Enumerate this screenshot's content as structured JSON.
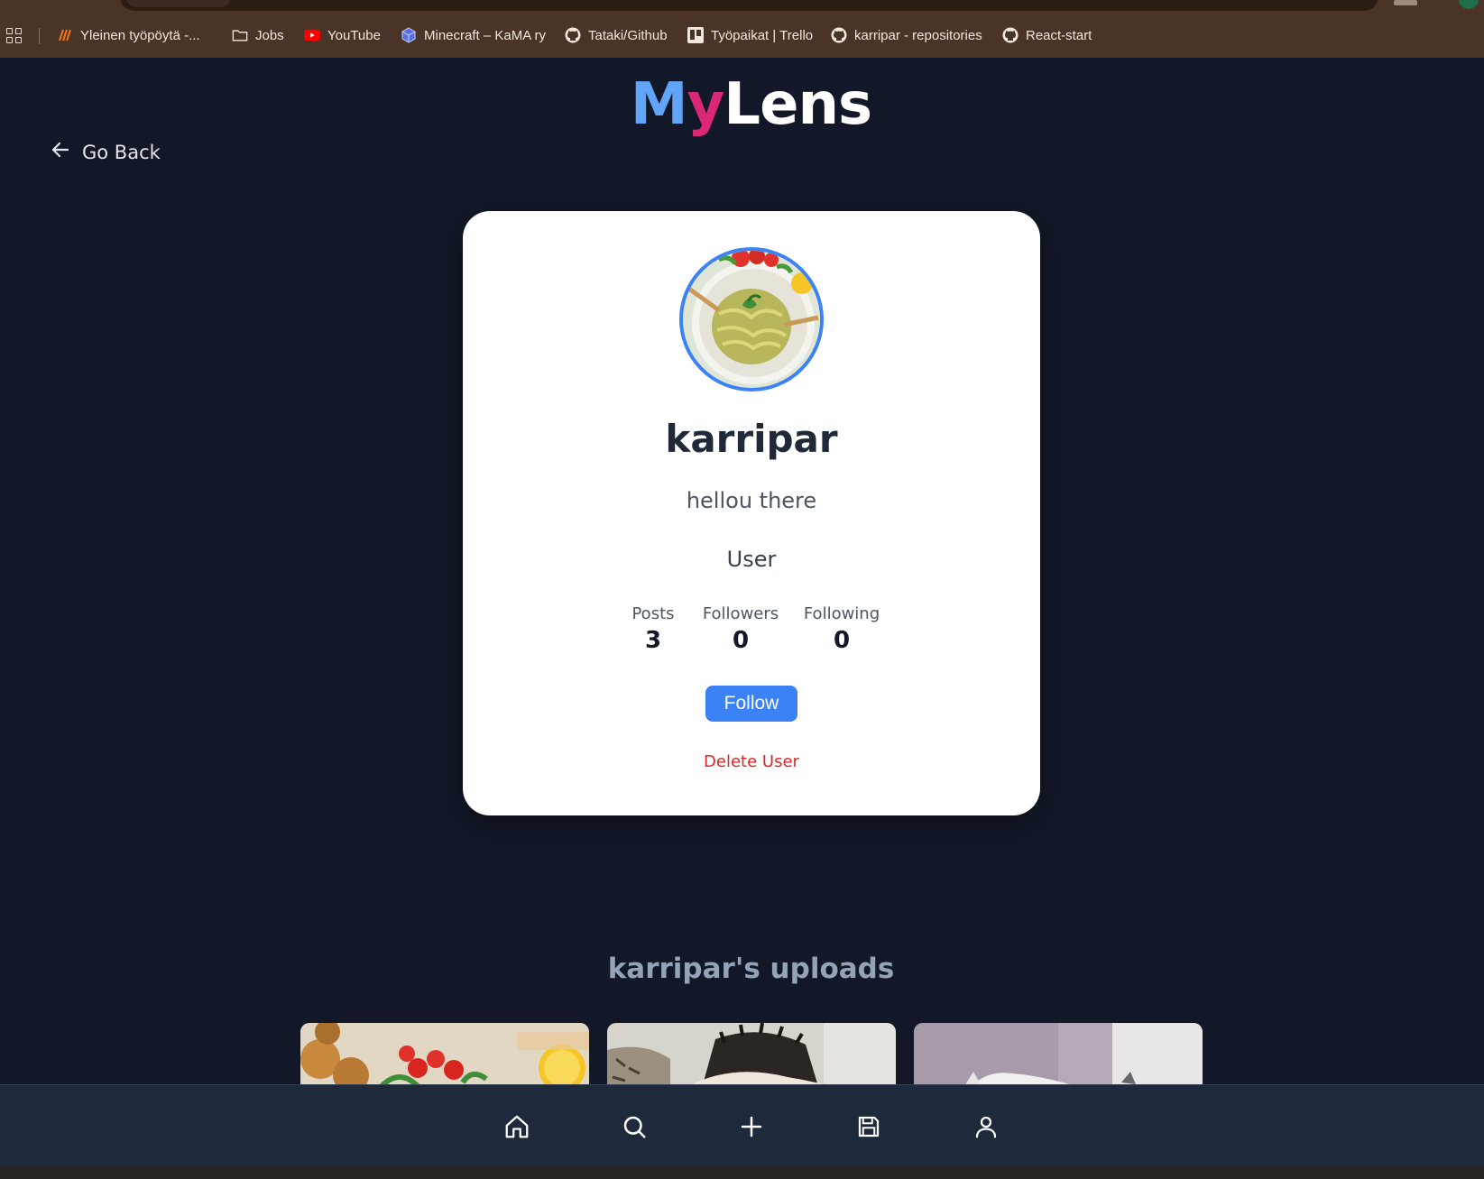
{
  "browser": {
    "bookmarks": [
      {
        "label": "Yleinen työpöytä -...",
        "icon": "workspace-icon"
      },
      {
        "label": "Jobs",
        "icon": "folder-icon"
      },
      {
        "label": "YouTube",
        "icon": "youtube-icon"
      },
      {
        "label": "Minecraft – KaMA ry",
        "icon": "cube-icon"
      },
      {
        "label": "Tataki/Github",
        "icon": "github-icon"
      },
      {
        "label": "Työpaikat | Trello",
        "icon": "trello-icon"
      },
      {
        "label": "karripar - repositories",
        "icon": "github-icon"
      },
      {
        "label": "React-start",
        "icon": "github-icon"
      }
    ]
  },
  "header": {
    "logo_part1": "M",
    "logo_part2": "y",
    "logo_part3": "Lens",
    "go_back_label": "Go Back"
  },
  "profile": {
    "username": "karripar",
    "bio": "hellou there",
    "role": "User",
    "stats": {
      "posts_label": "Posts",
      "posts_value": "3",
      "followers_label": "Followers",
      "followers_value": "0",
      "following_label": "Following",
      "following_value": "0"
    },
    "follow_label": "Follow",
    "delete_label": "Delete User"
  },
  "uploads": {
    "title": "karripar's uploads"
  },
  "nav": {
    "items": [
      "home-icon",
      "search-icon",
      "plus-icon",
      "save-icon",
      "user-icon"
    ]
  },
  "colors": {
    "background": "#121827",
    "accent": "#3b82f6",
    "danger": "#dc2626",
    "logo_blue": "#60a5fa",
    "logo_pink": "#db2777"
  }
}
